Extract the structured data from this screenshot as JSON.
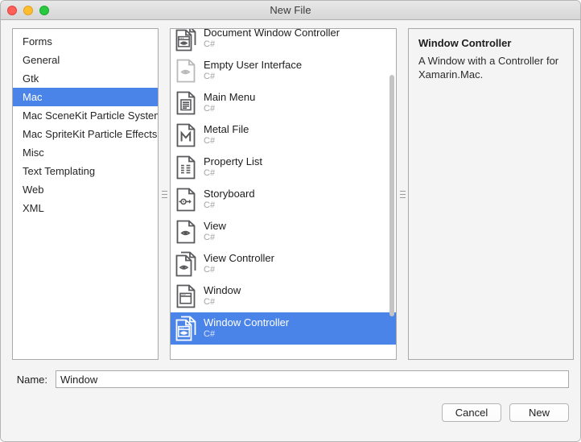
{
  "window": {
    "title": "New File",
    "traffic_lights": [
      {
        "name": "close-button",
        "color": "#ff5f57"
      },
      {
        "name": "minimize-button",
        "color": "#ffbd2e"
      },
      {
        "name": "maximize-button",
        "color": "#28c840"
      }
    ]
  },
  "categories": {
    "selected_index": 3,
    "items": [
      {
        "label": "Forms"
      },
      {
        "label": "General"
      },
      {
        "label": "Gtk"
      },
      {
        "label": "Mac"
      },
      {
        "label": "Mac SceneKit Particle Systems"
      },
      {
        "label": "Mac SpriteKit Particle Effects"
      },
      {
        "label": "Misc"
      },
      {
        "label": "Text Templating"
      },
      {
        "label": "Web"
      },
      {
        "label": "XML"
      }
    ]
  },
  "templates": {
    "selected_index": 9,
    "items": [
      {
        "label": "Document Window Controller",
        "language": "C#",
        "icon": "document-window-controller-icon"
      },
      {
        "label": "Empty User Interface",
        "language": "C#",
        "icon": "empty-user-interface-icon"
      },
      {
        "label": "Main Menu",
        "language": "C#",
        "icon": "main-menu-icon"
      },
      {
        "label": "Metal File",
        "language": "C#",
        "icon": "metal-file-icon"
      },
      {
        "label": "Property List",
        "language": "C#",
        "icon": "property-list-icon"
      },
      {
        "label": "Storyboard",
        "language": "C#",
        "icon": "storyboard-icon"
      },
      {
        "label": "View",
        "language": "C#",
        "icon": "view-icon"
      },
      {
        "label": "View Controller",
        "language": "C#",
        "icon": "view-controller-icon"
      },
      {
        "label": "Window",
        "language": "C#",
        "icon": "window-icon"
      },
      {
        "label": "Window Controller",
        "language": "C#",
        "icon": "window-controller-icon"
      }
    ]
  },
  "detail": {
    "title": "Window Controller",
    "description": "A Window with a Controller for Xamarin.Mac."
  },
  "name_field": {
    "label": "Name:",
    "value": "Window",
    "placeholder": ""
  },
  "footer": {
    "cancel_label": "Cancel",
    "new_label": "New"
  },
  "colors": {
    "selection_blue": "#4a84e8",
    "window_background": "#f4f4f4",
    "pane_background": "#ffffff"
  }
}
